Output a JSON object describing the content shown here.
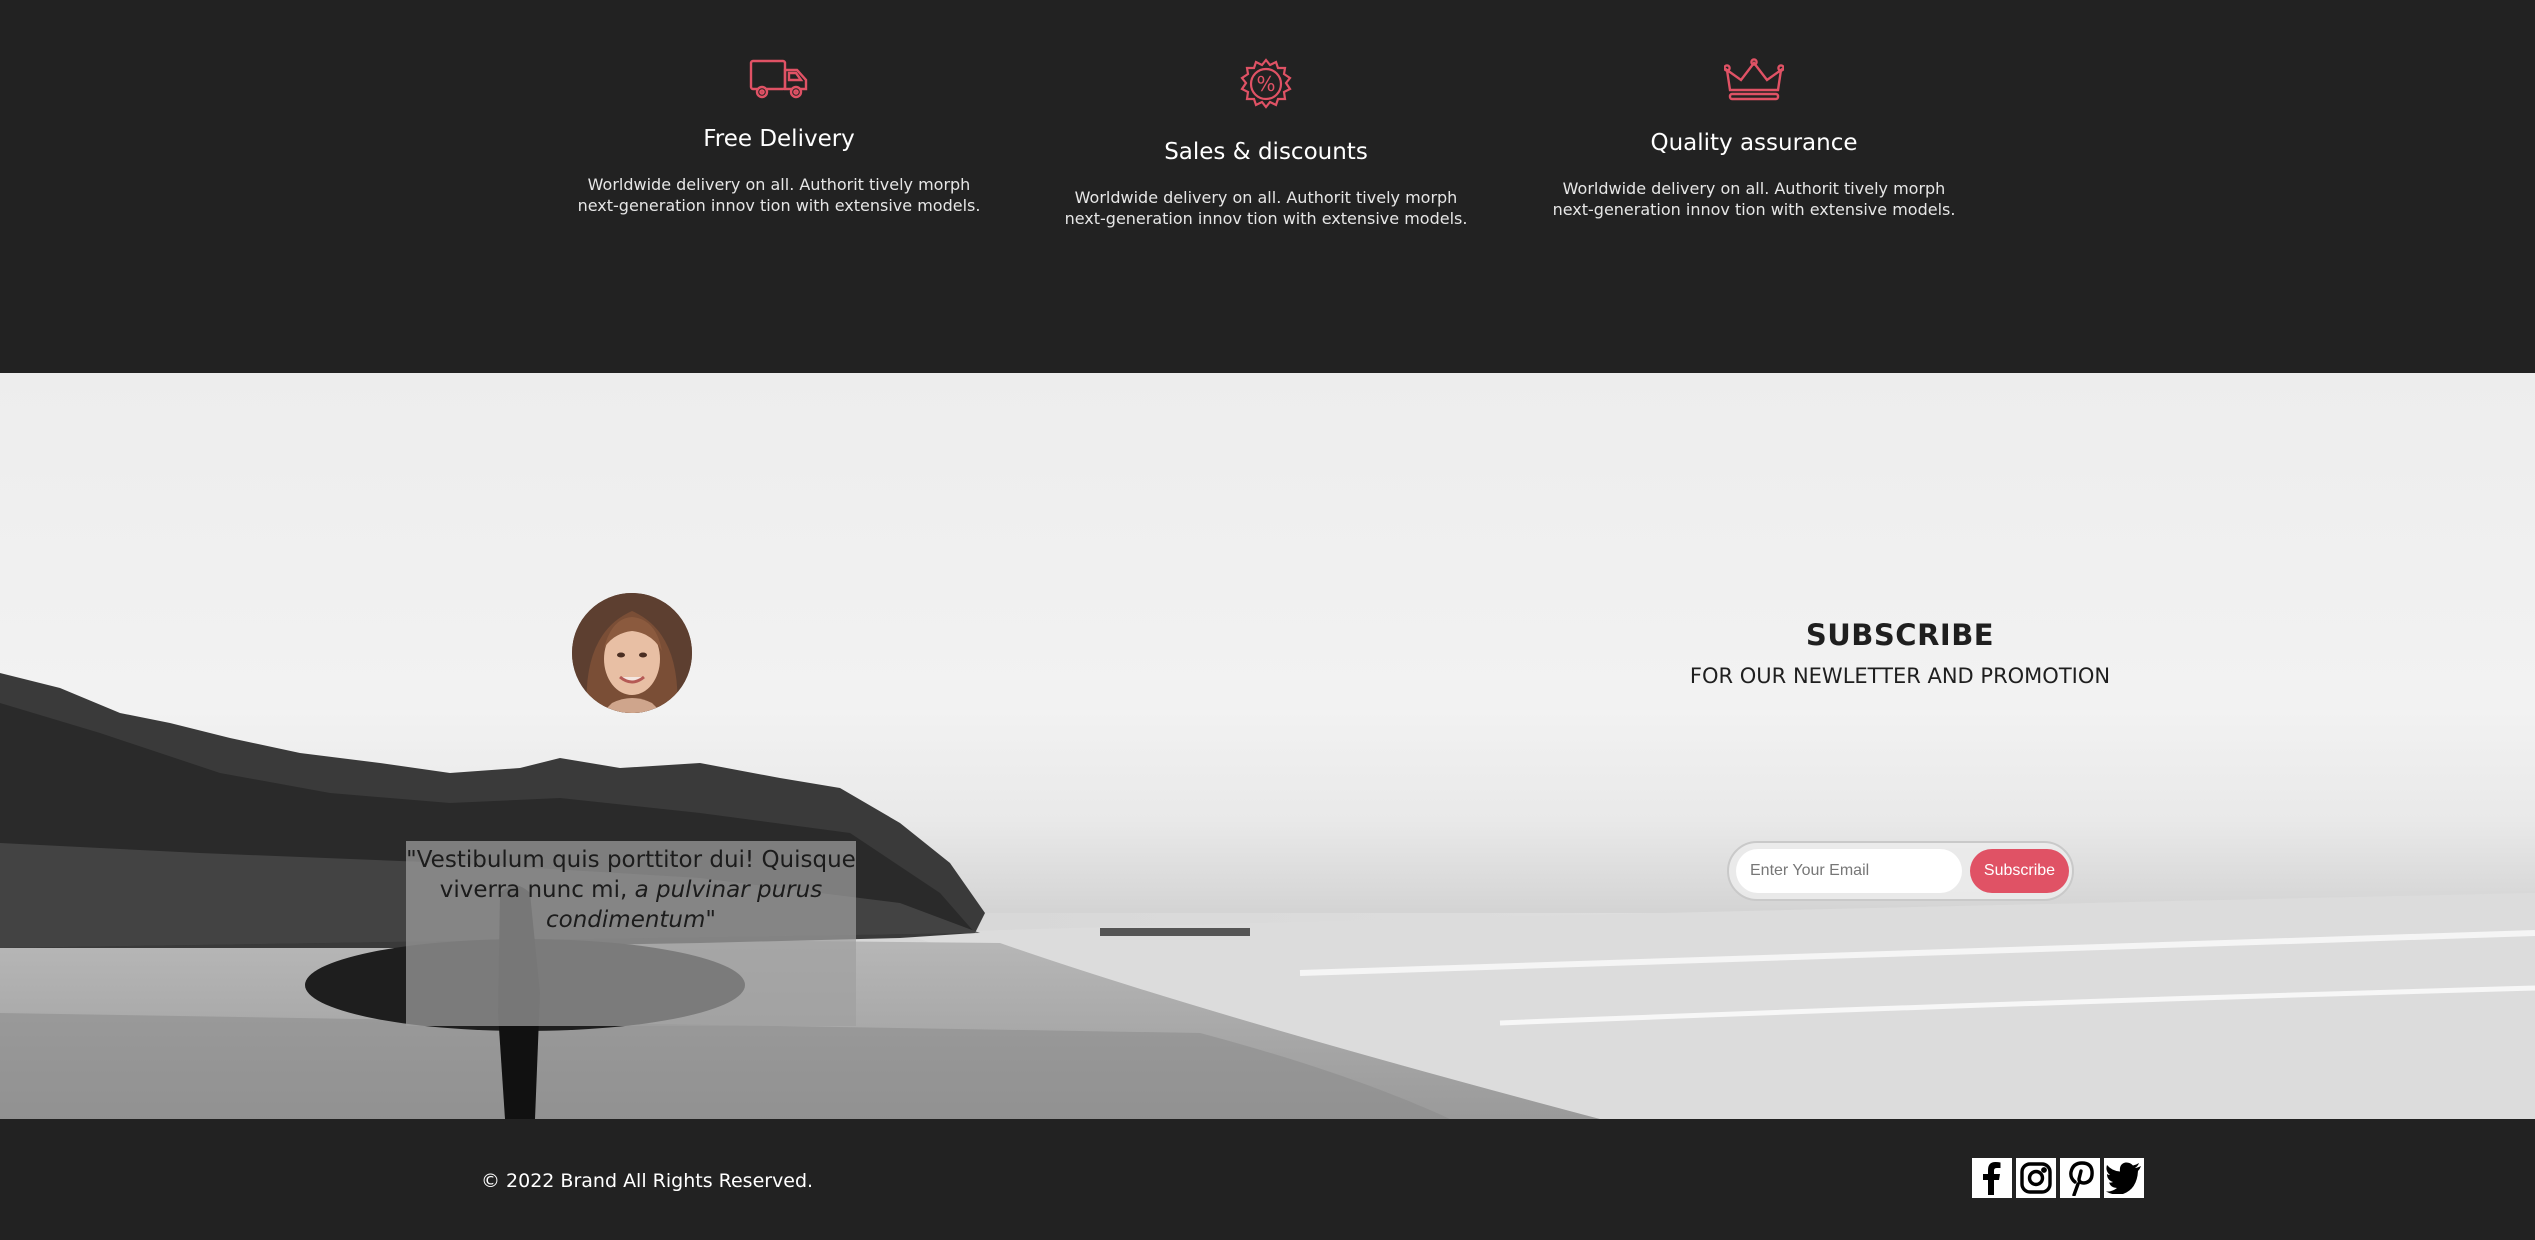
{
  "features": [
    {
      "icon": "delivery-truck-icon",
      "title": "Free Delivery",
      "description": "Worldwide delivery on all. Authorit tively morph next-generation innov tion with extensive models."
    },
    {
      "icon": "percent-badge-icon",
      "title": "Sales & discounts",
      "description": "Worldwide delivery on all. Authorit tively morph next-generation innov tion with extensive models."
    },
    {
      "icon": "crown-icon",
      "title": "Quality assurance",
      "description": "Worldwide delivery on all. Authorit tively morph next-generation innov tion with extensive models."
    }
  ],
  "testimonial": {
    "quote_plain": "\"Vestibulum quis porttitor dui! Quisque viverra nunc mi, ",
    "quote_italic": "a pulvinar purus condimentum\""
  },
  "subscribe": {
    "title": "SUBSCRIBE",
    "subtitle": "FOR OUR NEWLETTER AND PROMOTION",
    "email_placeholder": "Enter Your Email",
    "button_label": "Subscribe"
  },
  "footer": {
    "copyright": "© 2022 Brand All Rights Reserved.",
    "socials": [
      "facebook-icon",
      "instagram-icon",
      "pinterest-icon",
      "twitter-icon"
    ]
  },
  "colors": {
    "accent": "#e05265",
    "dark_background": "#222222",
    "text_light": "#ffffff"
  }
}
